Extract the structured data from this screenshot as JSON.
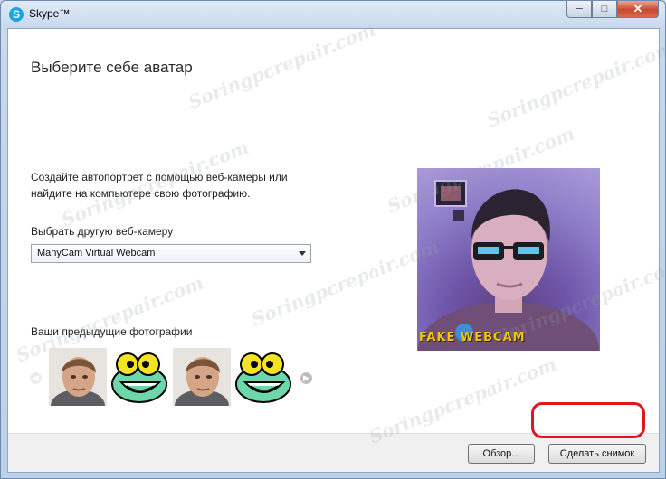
{
  "window": {
    "title": "Skype™",
    "logo_letter": "S",
    "controls": {
      "minimize": "─",
      "maximize": "□",
      "close": "✕"
    }
  },
  "heading": "Выберите себе аватар",
  "description": "Создайте автопортрет с помощью веб-камеры или найдите на компьютере свою фотографию.",
  "camera": {
    "label": "Выбрать другую веб-камеру",
    "selected": "ManyCam Virtual Webcam"
  },
  "webcam_overlay_text": "FAKE WEBCAM",
  "previous": {
    "label": "Ваши предыдущие фотографии",
    "thumbnails": [
      "man-photo",
      "frog-cartoon",
      "man-photo",
      "frog-cartoon"
    ]
  },
  "buttons": {
    "browse": "Обзор...",
    "snapshot": "Сделать снимок"
  },
  "watermark": "Soringpcrepair.com",
  "colors": {
    "highlight": "#e0141b",
    "skype_blue": "#1aa3e8"
  }
}
